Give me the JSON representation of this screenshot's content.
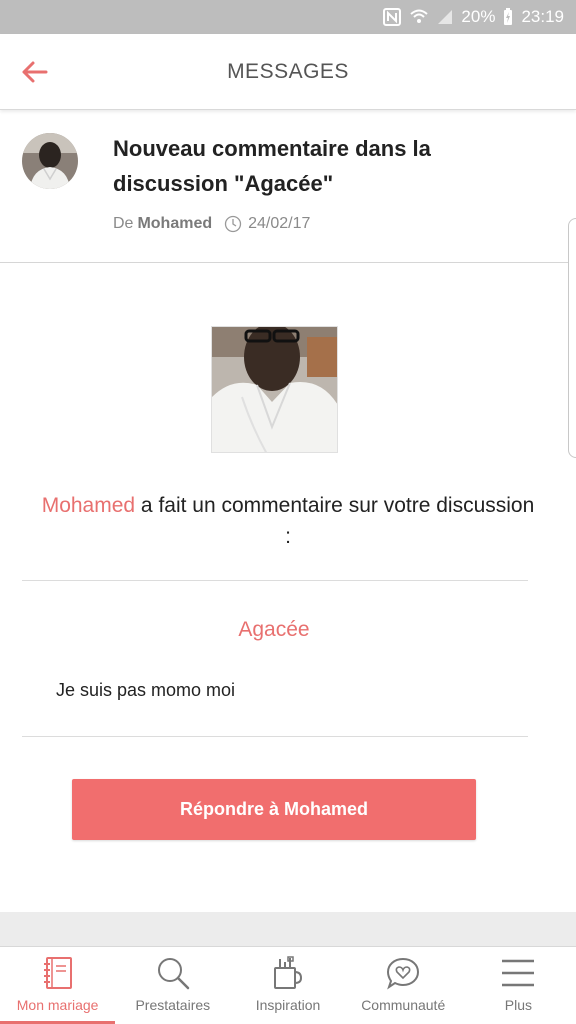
{
  "status_bar": {
    "battery": "20%",
    "time": "23:19"
  },
  "header": {
    "title": "MESSAGES"
  },
  "message": {
    "title": "Nouveau commentaire dans la discussion \"Agacée\"",
    "from_prefix": "De",
    "author": "Mohamed",
    "date": "24/02/17"
  },
  "body": {
    "commenter": "Mohamed",
    "intro_text": " a fait un commentaire sur votre discussion :",
    "discussion_name": "Agacée",
    "comment": "Je suis pas momo moi",
    "reply_button": "Répondre à Mohamed"
  },
  "nav": {
    "items": [
      {
        "label": "Mon mariage",
        "icon": "notebook-icon",
        "active": true
      },
      {
        "label": "Prestataires",
        "icon": "search-icon",
        "active": false
      },
      {
        "label": "Inspiration",
        "icon": "inspiration-icon",
        "active": false
      },
      {
        "label": "Communauté",
        "icon": "chat-heart-icon",
        "active": false
      },
      {
        "label": "Plus",
        "icon": "menu-icon",
        "active": false
      }
    ]
  },
  "colors": {
    "accent": "#e8706f",
    "button": "#f16e6e",
    "status_bar": "#bdbdbd"
  }
}
